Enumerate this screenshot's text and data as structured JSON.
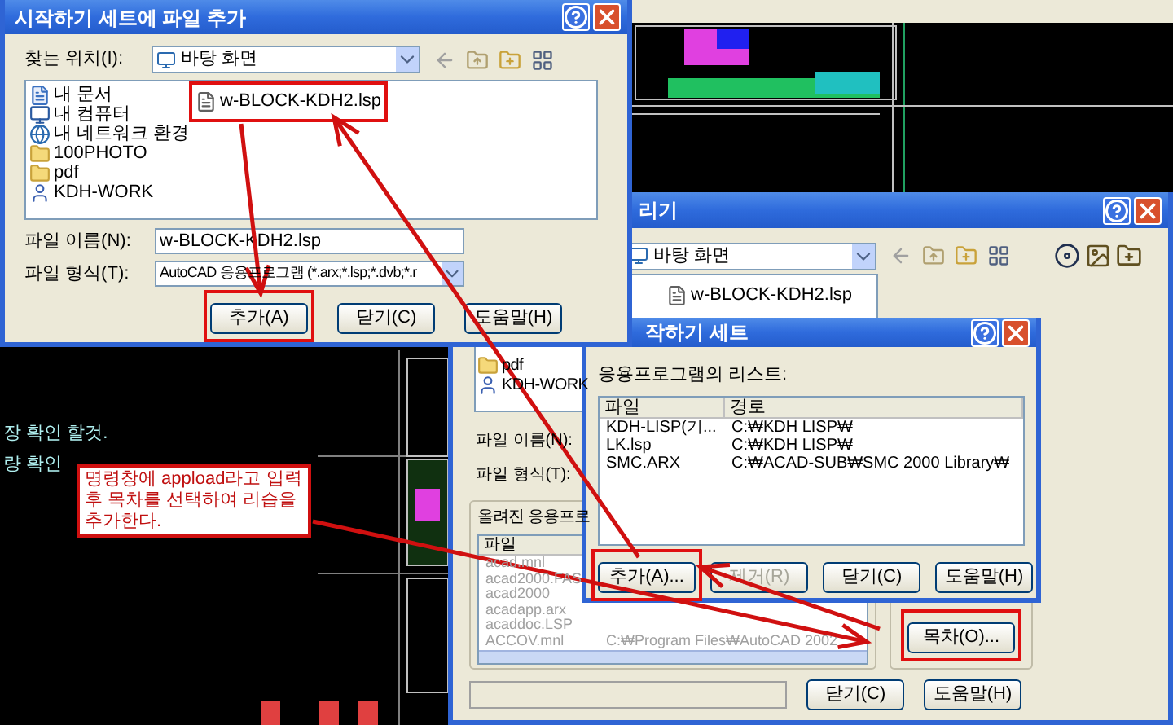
{
  "cad_notes": [
    "장 확인 할것.",
    "량 확인"
  ],
  "open_dialog": {
    "title": "리기",
    "location": "바탕 화면",
    "places": [
      {
        "name": "pdf",
        "kind": "folder"
      },
      {
        "name": "KDH-WORK",
        "kind": "shortcut"
      }
    ],
    "files": [
      {
        "name": "w-BLOCK-KDH2.lsp"
      }
    ],
    "filename_label": "파일 이름(N):",
    "filetype_label": "파일 형식(T):",
    "loaded_group": "올려진 응용프로",
    "loaded_columns": [
      "파일"
    ],
    "loaded_rows": [
      {
        "file": "acad.mnl"
      },
      {
        "file": "acad2000.FAS"
      },
      {
        "file": "acad2000"
      },
      {
        "file": "acadapp.arx"
      },
      {
        "file": "acaddoc.LSP"
      },
      {
        "file": "ACCOV.mnl",
        "path": "C:₩Program Files₩AutoCAD 2002"
      }
    ],
    "side_buttons": [
      {
        "label": "목차(O)...",
        "highlighted": true
      }
    ],
    "bottom_buttons": [
      {
        "label": "닫기(C)"
      },
      {
        "label": "도움말(H)"
      }
    ]
  },
  "startup_dialog": {
    "title": "작하기 세트",
    "list_label": "응용프로그램의 리스트:",
    "columns": [
      "파일",
      "경로"
    ],
    "rows": [
      {
        "file": "KDH-LISP(기...",
        "path": "C:₩KDH LISP₩"
      },
      {
        "file": "LK.lsp",
        "path": "C:₩KDH LISP₩"
      },
      {
        "file": "SMC.ARX",
        "path": "C:₩ACAD-SUB₩SMC 2000 Library₩"
      }
    ],
    "buttons": [
      {
        "label": "추가(A)...",
        "disabled": false,
        "highlighted": true
      },
      {
        "label": "제거(R)",
        "disabled": true,
        "highlighted": false
      },
      {
        "label": "닫기(C)",
        "disabled": false,
        "highlighted": false
      },
      {
        "label": "도움말(H)",
        "disabled": false,
        "highlighted": false
      }
    ]
  },
  "add_file_dialog": {
    "title": "시작하기 세트에 파일 추가",
    "location_label": "찾는 위치(I):",
    "location": "바탕 화면",
    "places": [
      {
        "name": "내 문서",
        "kind": "documents"
      },
      {
        "name": "내 컴퓨터",
        "kind": "computer"
      },
      {
        "name": "내 네트워크 환경",
        "kind": "network"
      },
      {
        "name": "100PHOTO",
        "kind": "folder"
      },
      {
        "name": "pdf",
        "kind": "folder"
      },
      {
        "name": "KDH-WORK",
        "kind": "shortcut"
      }
    ],
    "files": [
      {
        "name": "w-BLOCK-KDH2.lsp",
        "highlighted": true
      }
    ],
    "filename_label": "파일 이름(N):",
    "filename": "w-BLOCK-KDH2.lsp",
    "filetype_label": "파일 형식(T):",
    "filetype": "AutoCAD 응용프로그램 (*.arx;*.lsp;*.dvb;*.r",
    "buttons": [
      {
        "label": "추가(A)",
        "highlighted": true
      },
      {
        "label": "닫기(C)",
        "highlighted": false
      },
      {
        "label": "도움말(H)",
        "highlighted": false
      }
    ]
  },
  "annotation": {
    "text": "명령창에 appload라고 입력후 목차를 선택하여 리습을 추가한다."
  }
}
